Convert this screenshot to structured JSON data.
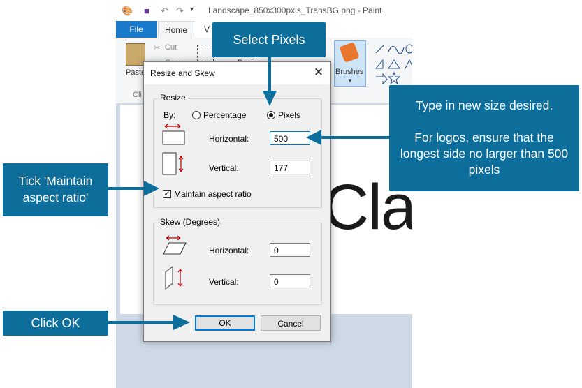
{
  "paint": {
    "title": "Landscape_850x300pxls_TransBG.png - Paint",
    "tabs": {
      "file": "File",
      "home": "Home",
      "view": "V"
    },
    "ribbon": {
      "paste": "Paste",
      "cut": "Cut",
      "copy": "Copy",
      "resize": "Resize",
      "brushes": "Brushes",
      "clipboard_group": "Cli"
    },
    "canvas_text": "Cla"
  },
  "dialog": {
    "title": "Resize and Skew",
    "close": "✕",
    "resize": {
      "group_label": "Resize",
      "by_label": "By:",
      "percentage_label": "Percentage",
      "pixels_label": "Pixels",
      "selected": "pixels",
      "horizontal_label": "Horizontal:",
      "horizontal_value": "500",
      "vertical_label": "Vertical:",
      "vertical_value": "177",
      "maintain_label": "Maintain aspect ratio",
      "maintain_checked": true
    },
    "skew": {
      "group_label": "Skew (Degrees)",
      "horizontal_label": "Horizontal:",
      "horizontal_value": "0",
      "vertical_label": "Vertical:",
      "vertical_value": "0"
    },
    "ok": "OK",
    "cancel": "Cancel"
  },
  "callouts": {
    "select_pixels": "Select Pixels",
    "type_size_line1": "Type in new size desired.",
    "type_size_line2": "For logos, ensure that the longest side no larger than 500 pixels",
    "tick_maintain": "Tick 'Maintain aspect ratio'",
    "click_ok": "Click OK"
  },
  "colors": {
    "callout_bg": "#0d6e9c",
    "arrow": "#0d6e9c",
    "focus": "#0078d7",
    "red_arrow": "#c00000"
  }
}
